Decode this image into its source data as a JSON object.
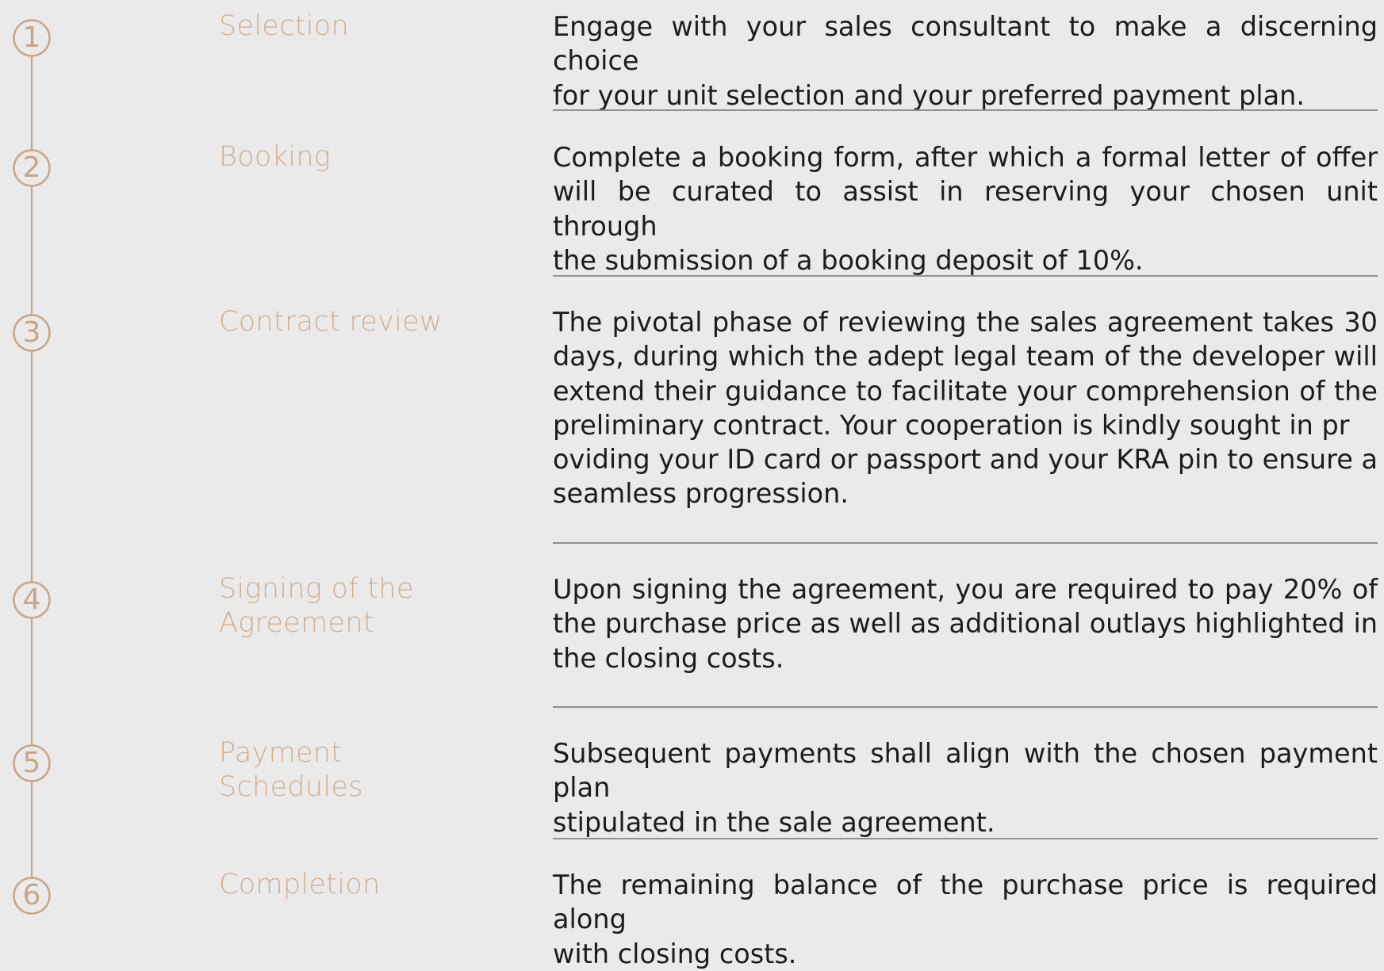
{
  "steps": [
    {
      "number": "1",
      "title": "Selection",
      "description_lines": [
        "Engage with your sales consultant to make a discerning choice",
        "for your unit selection and your preferred payment plan."
      ]
    },
    {
      "number": "2",
      "title": "Booking",
      "description_lines": [
        "Complete a booking form, after which a formal letter of offer",
        "will be curated to assist in reserving your chosen unit through",
        "the submission of a booking deposit of 10%."
      ]
    },
    {
      "number": "3",
      "title": "Contract review",
      "description_lines": [
        "The pivotal phase of reviewing the sales agreement takes 30",
        "days, during which the adept legal team of the developer will",
        "extend their guidance to facilitate your comprehension of the",
        "preliminary contract. Your cooperation is kindly sought in pr",
        "oviding your ID card or passport and your KRA pin to ensure a",
        "seamless progression."
      ]
    },
    {
      "number": "4",
      "title": "Signing of the Agreement",
      "title_lines": [
        "Signing of the",
        "Agreement"
      ],
      "description_lines": [
        "Upon signing the agreement, you are required to pay 20% of",
        "the purchase price as well as additional outlays highlighted in",
        "the closing costs."
      ]
    },
    {
      "number": "5",
      "title": "Payment Schedules",
      "title_lines": [
        "Payment",
        "Schedules"
      ],
      "description_lines": [
        "Subsequent payments shall align with the chosen payment plan",
        "stipulated in the sale agreement."
      ]
    },
    {
      "number": "6",
      "title": "Completion",
      "description_lines": [
        "The remaining balance of the purchase price is required along",
        "with closing costs."
      ]
    }
  ],
  "colors": {
    "background": "#eaeaea",
    "accent": "#c9a586",
    "title": "#d1af90",
    "text": "#1c1c1c",
    "divider": "#8f8f8f"
  }
}
